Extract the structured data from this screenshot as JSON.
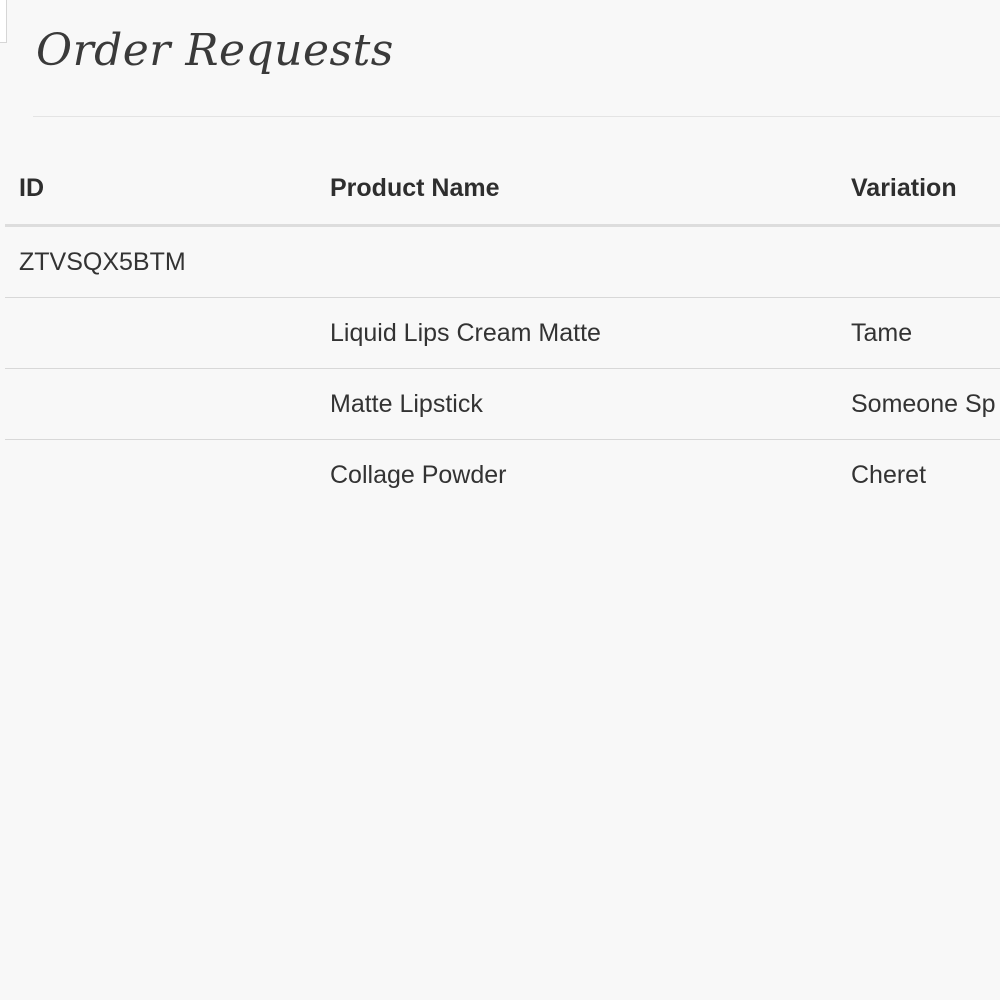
{
  "page": {
    "title": "Order Requests"
  },
  "table": {
    "columns": [
      "ID",
      "Product Name",
      "Variation"
    ],
    "rows": [
      {
        "id": "ZTVSQX5BTM",
        "product": "",
        "variation": ""
      },
      {
        "id": "",
        "product": "Liquid Lips Cream Matte",
        "variation": "Tame"
      },
      {
        "id": "",
        "product": "Matte Lipstick",
        "variation": "Someone Sp"
      },
      {
        "id": "",
        "product": "Collage Powder",
        "variation": "Cheret"
      }
    ]
  }
}
